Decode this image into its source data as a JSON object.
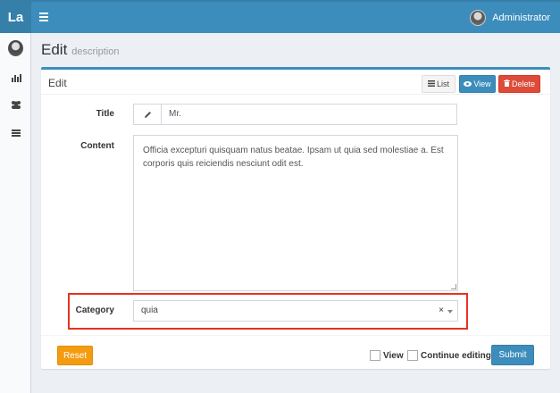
{
  "app": {
    "logo": "La",
    "user_name": "Administrator"
  },
  "header": {
    "title": "Edit",
    "subtitle": "description"
  },
  "box": {
    "title": "Edit",
    "list_label": "List",
    "view_label": "View",
    "delete_label": "Delete"
  },
  "form": {
    "title_label": "Title",
    "title_value": "Mr.",
    "content_label": "Content",
    "content_value": "Officia excepturi quisquam natus beatae. Ipsam ut quia sed molestiae a. Est corporis quis reiciendis nesciunt odit est.",
    "category_label": "Category",
    "category_value": "quia",
    "category_clear": "×"
  },
  "footer": {
    "reset_label": "Reset",
    "view_check_label": "View",
    "continue_check_label": "Continue editing",
    "submit_label": "Submit"
  },
  "icons": {
    "menu": "hamburger-icon",
    "chart": "bar-chart-icon",
    "users": "users-icon",
    "list": "list-icon",
    "pencil": "pencil-icon",
    "eye": "eye-icon",
    "trash": "trash-icon"
  },
  "colors": {
    "primary": "#3c8dbc",
    "danger": "#dd4b39",
    "warning": "#f39c12",
    "highlight": "#e8311f"
  }
}
